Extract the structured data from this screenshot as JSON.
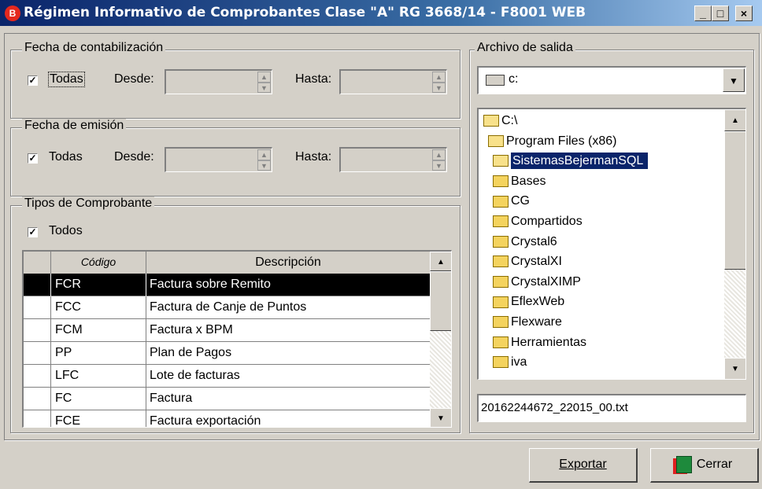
{
  "window": {
    "title": "Régimen Informativo de Comprobantes Clase \"A\" RG 3668/14 - F8001 WEB",
    "icon": "app-logo-icon",
    "controls": {
      "minimize": "_",
      "maximize": "□",
      "close": "×"
    }
  },
  "fecha_contabilizacion": {
    "legend": "Fecha de contabilización",
    "todas_label": "Todas",
    "todas_checked": true,
    "desde_label": "Desde:",
    "desde_value": "",
    "hasta_label": "Hasta:",
    "hasta_value": ""
  },
  "fecha_emision": {
    "legend": "Fecha de emisión",
    "todas_label": "Todas",
    "todas_checked": true,
    "desde_label": "Desde:",
    "desde_value": "",
    "hasta_label": "Hasta:",
    "hasta_value": ""
  },
  "tipos": {
    "legend": "Tipos de Comprobante",
    "todos_label": "Todos",
    "todos_checked": true,
    "columns": [
      "Código",
      "Descripción"
    ],
    "rows": [
      {
        "codigo": "FCR",
        "descripcion": "Factura sobre Remito",
        "selected": true
      },
      {
        "codigo": "FCC",
        "descripcion": "Factura de Canje de Puntos",
        "selected": false
      },
      {
        "codigo": "FCM",
        "descripcion": "Factura x BPM",
        "selected": false
      },
      {
        "codigo": "PP",
        "descripcion": "Plan de Pagos",
        "selected": false
      },
      {
        "codigo": "LFC",
        "descripcion": "Lote de facturas",
        "selected": false
      },
      {
        "codigo": "FC",
        "descripcion": "Factura",
        "selected": false
      },
      {
        "codigo": "FCE",
        "descripcion": "Factura exportación",
        "selected": false
      }
    ]
  },
  "archivo": {
    "legend": "Archivo de salida",
    "drive": "c:",
    "folders": [
      {
        "name": "C:\\",
        "open": true,
        "selected": false
      },
      {
        "name": "Program Files (x86)",
        "open": true,
        "selected": false
      },
      {
        "name": "SistemasBejermanSQL",
        "open": true,
        "selected": true
      },
      {
        "name": "Bases",
        "open": false,
        "selected": false
      },
      {
        "name": "CG",
        "open": false,
        "selected": false
      },
      {
        "name": "Compartidos",
        "open": false,
        "selected": false
      },
      {
        "name": "Crystal6",
        "open": false,
        "selected": false
      },
      {
        "name": "CrystalXI",
        "open": false,
        "selected": false
      },
      {
        "name": "CrystalXIMP",
        "open": false,
        "selected": false
      },
      {
        "name": "EflexWeb",
        "open": false,
        "selected": false
      },
      {
        "name": "Flexware",
        "open": false,
        "selected": false
      },
      {
        "name": "Herramientas",
        "open": false,
        "selected": false
      },
      {
        "name": "iva",
        "open": false,
        "selected": false
      }
    ],
    "filename": "20162244672_22015_00.txt"
  },
  "buttons": {
    "exportar": "Exportar",
    "cerrar": "Cerrar"
  },
  "colors": {
    "selection": "#0a246a",
    "row_selected": "#000000",
    "face": "#d4d0c8"
  }
}
